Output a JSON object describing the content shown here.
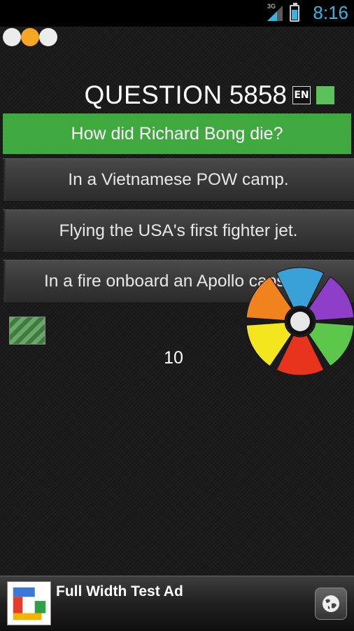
{
  "status_bar": {
    "network": "3G",
    "time": "8:16"
  },
  "progress_dots": [
    {
      "color": "#ececec"
    },
    {
      "color": "#f5a623"
    },
    {
      "color": "#ececec"
    }
  ],
  "header": {
    "question_label": "QUESTION",
    "question_number": "5858",
    "language_code": "EN",
    "status_color": "#5bc15b"
  },
  "question": {
    "text": "How did Richard Bong die?",
    "color": "#3fa83f"
  },
  "answers": [
    {
      "label": "In a Vietnamese POW camp."
    },
    {
      "label": "Flying the USA's first fighter jet."
    },
    {
      "label": "In a fire onboard an Apollo capsule."
    }
  ],
  "timer": {
    "value": "10"
  },
  "category_wheel": {
    "segments": [
      "blue",
      "purple",
      "green",
      "red",
      "yellow",
      "orange"
    ],
    "colors": [
      "#3aa0d8",
      "#8e3ec9",
      "#5cc74a",
      "#e8341c",
      "#f4e61e",
      "#f0831e"
    ]
  },
  "ad": {
    "title": "Full Width Test Ad",
    "logo_icon": "google-logo-icon",
    "action_icon": "globe-icon"
  }
}
